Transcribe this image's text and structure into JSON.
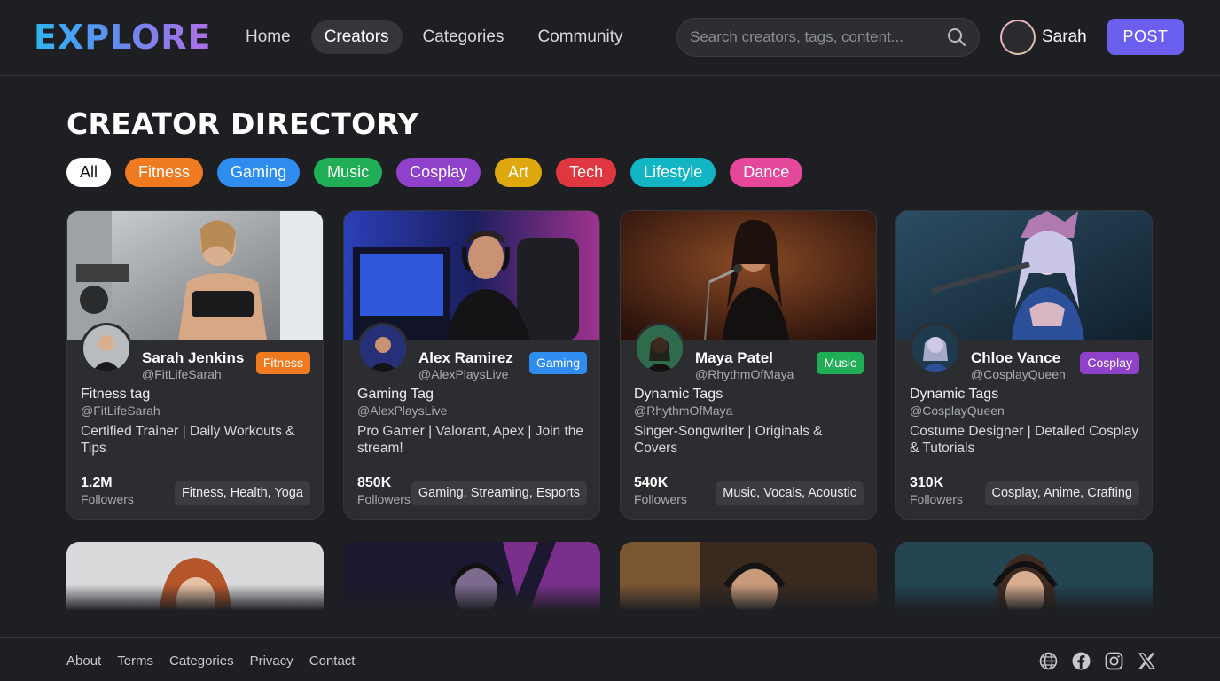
{
  "header": {
    "logo": "EXPLORE",
    "nav": [
      "Home",
      "Creators",
      "Categories",
      "Community"
    ],
    "active_nav": "Creators",
    "search_placeholder": "Search creators, tags, content...",
    "user_name": "Sarah",
    "post_label": "POST"
  },
  "page_title": "CREATOR DIRECTORY",
  "filters": [
    {
      "label": "All",
      "color": "#ffffff"
    },
    {
      "label": "Fitness",
      "color": "#f07a1f"
    },
    {
      "label": "Gaming",
      "color": "#2f8df0"
    },
    {
      "label": "Music",
      "color": "#1fae55"
    },
    {
      "label": "Cosplay",
      "color": "#8f42c9"
    },
    {
      "label": "Art",
      "color": "#e0a80f"
    },
    {
      "label": "Tech",
      "color": "#e0363f"
    },
    {
      "label": "Lifestyle",
      "color": "#12b5c4"
    },
    {
      "label": "Dance",
      "color": "#e5479b"
    }
  ],
  "creators": [
    {
      "name": "Sarah Jenkins",
      "handle": "@FitLifeSarah",
      "badge": "Fitness",
      "badge_color": "#f07a1f",
      "tag_title": "Fitness tag",
      "tag_handle": "@FitLifeSarah",
      "bio": "Certified Trainer | Daily Workouts & Tips",
      "followers": "1.2M",
      "followers_label": "Followers",
      "tags": "Fitness, Health, Yoga"
    },
    {
      "name": "Alex Ramirez",
      "handle": "@AlexPlaysLive",
      "badge": "Gaming",
      "badge_color": "#2f8df0",
      "tag_title": "Gaming Tag",
      "tag_handle": "@AlexPlaysLive",
      "bio": "Pro Gamer | Valorant, Apex | Join the stream!",
      "followers": "850K",
      "followers_label": "Followers",
      "tags": "Gaming, Streaming, Esports"
    },
    {
      "name": "Maya Patel",
      "handle": "@RhythmOfMaya",
      "badge": "Music",
      "badge_color": "#1fae55",
      "tag_title": "Dynamic Tags",
      "tag_handle": "@RhythmOfMaya",
      "bio": "Singer-Songwriter | Originals & Covers",
      "followers": "540K",
      "followers_label": "Followers",
      "tags": "Music, Vocals, Acoustic"
    },
    {
      "name": "Chloe Vance",
      "handle": "@CosplayQueen",
      "badge": "Cosplay",
      "badge_color": "#8f42c9",
      "tag_title": "Dynamic Tags",
      "tag_handle": "@CosplayQueen",
      "bio": "Costume Designer | Detailed Cosplay & Tutorials",
      "followers": "310K",
      "followers_label": "Followers",
      "tags": "Cosplay, Anime, Crafting"
    }
  ],
  "footer": {
    "links": [
      "About",
      "Terms",
      "Categories",
      "Privacy",
      "Contact"
    ],
    "social_icons": [
      "globe-icon",
      "facebook-icon",
      "instagram-icon",
      "x-icon"
    ]
  }
}
